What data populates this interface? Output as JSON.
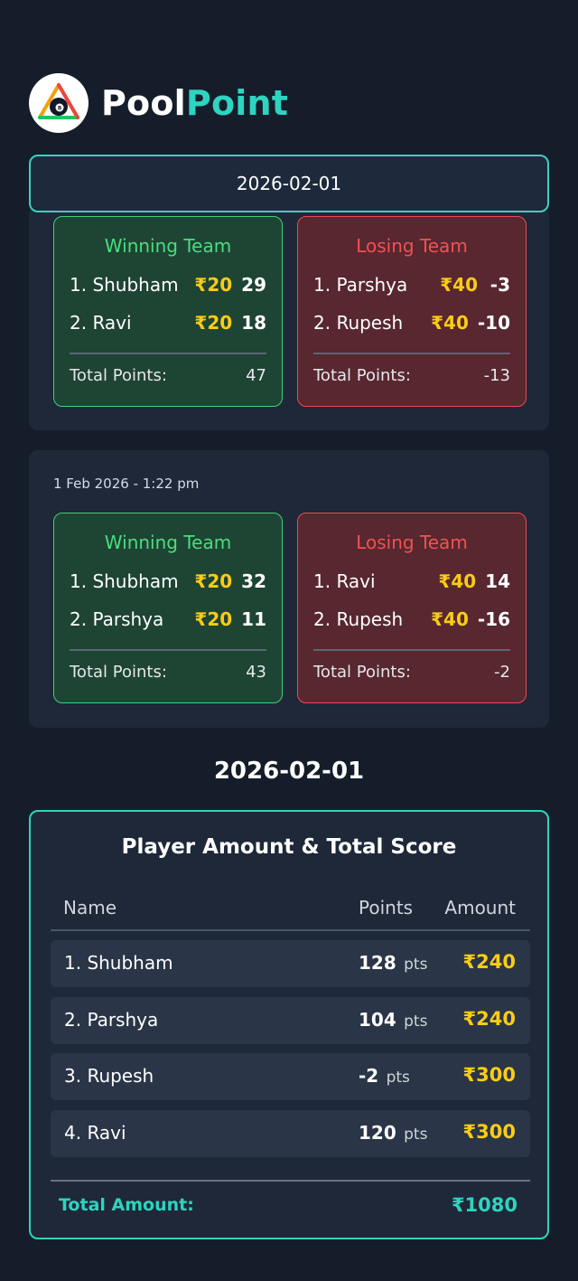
{
  "app": {
    "name_part1": "Pool",
    "name_part2": "Point",
    "logo_icon": "billiard-8-ball-triangle-icon"
  },
  "date_picker": {
    "value": "2026-02-01"
  },
  "matches": [
    {
      "time": "",
      "winning": {
        "title": "Winning Team",
        "players": [
          {
            "name": "1. Shubham",
            "amount": "₹20",
            "points": "29"
          },
          {
            "name": "2. Ravi",
            "amount": "₹20",
            "points": "18"
          }
        ],
        "total_label": "Total Points:",
        "total": "47"
      },
      "losing": {
        "title": "Losing Team",
        "players": [
          {
            "name": "1. Parshya",
            "amount": "₹40",
            "points": "-3"
          },
          {
            "name": "2. Rupesh",
            "amount": "₹40",
            "points": "-10"
          }
        ],
        "total_label": "Total Points:",
        "total": "-13"
      }
    },
    {
      "time": "1 Feb 2026 - 1:22 pm",
      "winning": {
        "title": "Winning Team",
        "players": [
          {
            "name": "1. Shubham",
            "amount": "₹20",
            "points": "32"
          },
          {
            "name": "2. Parshya",
            "amount": "₹20",
            "points": "11"
          }
        ],
        "total_label": "Total Points:",
        "total": "43"
      },
      "losing": {
        "title": "Losing Team",
        "players": [
          {
            "name": "1. Ravi",
            "amount": "₹40",
            "points": "14"
          },
          {
            "name": "2. Rupesh",
            "amount": "₹40",
            "points": "-16"
          }
        ],
        "total_label": "Total Points:",
        "total": "-2"
      }
    }
  ],
  "summary": {
    "date": "2026-02-01",
    "title": "Player Amount & Total Score",
    "columns": {
      "name": "Name",
      "points": "Points",
      "amount": "Amount"
    },
    "rows": [
      {
        "name": "1. Shubham",
        "points": "128",
        "unit": "pts",
        "amount": "₹240"
      },
      {
        "name": "2. Parshya",
        "points": "104",
        "unit": "pts",
        "amount": "₹240"
      },
      {
        "name": "3. Rupesh",
        "points": "-2",
        "unit": "pts",
        "amount": "₹300"
      },
      {
        "name": "4. Ravi",
        "points": "120",
        "unit": "pts",
        "amount": "₹300"
      }
    ],
    "total_label": "Total Amount:",
    "total_value": "₹1080"
  },
  "colors": {
    "background": "#151d2a",
    "accent_teal": "#2dd4bf",
    "win_green": "#4ade80",
    "lose_red": "#f05252",
    "amount_yellow": "#facc15"
  }
}
